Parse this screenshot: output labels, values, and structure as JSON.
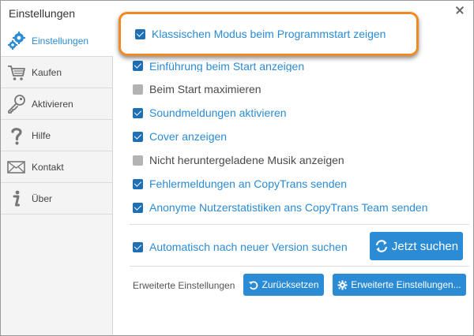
{
  "window": {
    "title": "Einstellungen"
  },
  "sidebar": {
    "items": [
      {
        "label": "Einstellungen",
        "icon": "gears-icon",
        "active": true
      },
      {
        "label": "Kaufen",
        "icon": "cart-icon"
      },
      {
        "label": "Aktivieren",
        "icon": "key-icon"
      },
      {
        "label": "Hilfe",
        "icon": "question-icon"
      },
      {
        "label": "Kontakt",
        "icon": "envelope-icon"
      },
      {
        "label": "Über",
        "icon": "info-icon"
      }
    ]
  },
  "options": [
    {
      "label": "Klassischen Modus beim Programmstart zeigen",
      "checked": true
    },
    {
      "label": "Einführung beim Start anzeigen",
      "checked": true
    },
    {
      "label": "Beim Start maximieren",
      "checked": false
    },
    {
      "label": "Soundmeldungen aktivieren",
      "checked": true
    },
    {
      "label": "Cover anzeigen",
      "checked": true
    },
    {
      "label": "Nicht heruntergeladene Musik anzeigen",
      "checked": false
    },
    {
      "label": "Fehlermeldungen an CopyTrans senden",
      "checked": true
    },
    {
      "label": "Anonyme Nutzerstatistiken ans CopyTrans Team senden",
      "checked": true
    }
  ],
  "update": {
    "label": "Automatisch nach neuer Version suchen",
    "checked": true,
    "button": "Jetzt suchen"
  },
  "advanced": {
    "label": "Erweiterte Einstellungen",
    "reset_button": "Zurücksetzen",
    "advanced_button": "Erweiterte Einstellungen..."
  },
  "colors": {
    "accent": "#2b8bd4",
    "highlight": "#f08a24",
    "checkbox": "#1f6fb5"
  }
}
